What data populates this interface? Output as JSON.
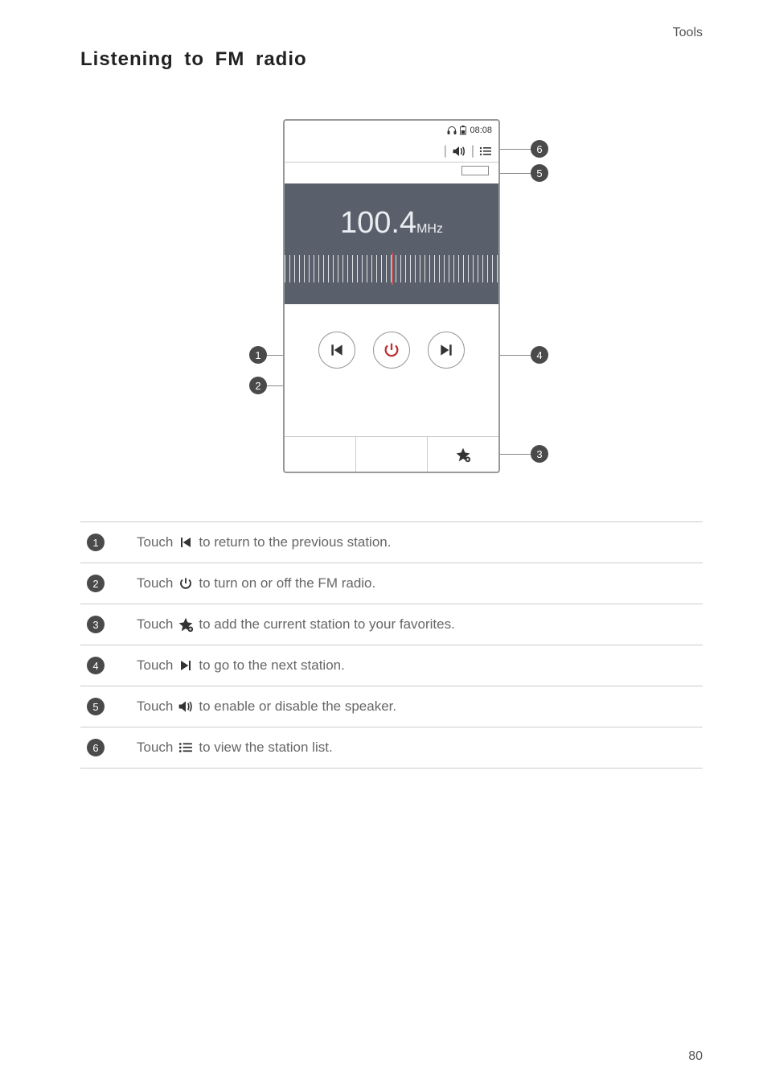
{
  "header": {
    "section": "Tools"
  },
  "heading": "Listening  to  FM  radio",
  "radio": {
    "status_time": "08:08",
    "frequency_value": "100.4",
    "frequency_unit": "MHz"
  },
  "callouts": {
    "1": "1",
    "2": "2",
    "3": "3",
    "4": "4",
    "5": "5",
    "6": "6"
  },
  "rows": {
    "1": {
      "pre": "Touch",
      "post": "to return to the previous station."
    },
    "2": {
      "pre": "Touch",
      "post": "to turn on or off the FM radio."
    },
    "3": {
      "pre": "Touch",
      "post": "to add the current station to your favorites."
    },
    "4": {
      "pre": "Touch",
      "post": "to go to the next station."
    },
    "5": {
      "pre": "Touch",
      "post": "to enable or disable the speaker."
    },
    "6": {
      "pre": "Touch",
      "post": "to view the station list."
    }
  },
  "page_number": "80"
}
